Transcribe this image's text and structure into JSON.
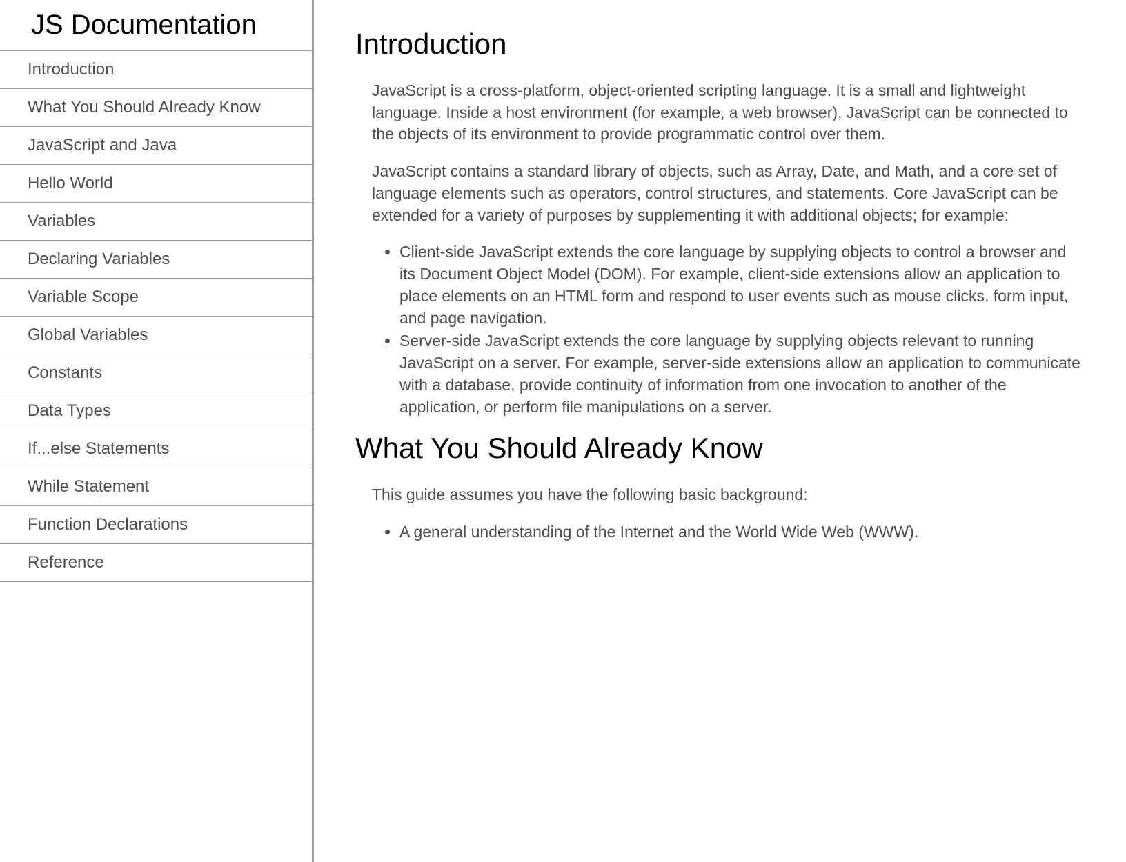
{
  "sidebar": {
    "title": "JS Documentation",
    "items": [
      "Introduction",
      "What You Should Already Know",
      "JavaScript and Java",
      "Hello World",
      "Variables",
      "Declaring Variables",
      "Variable Scope",
      "Global Variables",
      "Constants",
      "Data Types",
      "If...else Statements",
      "While Statement",
      "Function Declarations",
      "Reference"
    ]
  },
  "sections": {
    "introduction": {
      "heading": "Introduction",
      "p1": "JavaScript is a cross-platform, object-oriented scripting language. It is a small and lightweight language. Inside a host environment (for example, a web browser), JavaScript can be connected to the objects of its environment to provide programmatic control over them.",
      "p2": "JavaScript contains a standard library of objects, such as Array, Date, and Math, and a core set of language elements such as operators, control structures, and statements. Core JavaScript can be extended for a variety of purposes by supplementing it with additional objects; for example:",
      "li1": "Client-side JavaScript extends the core language by supplying objects to control a browser and its Document Object Model (DOM). For example, client-side extensions allow an application to place elements on an HTML form and respond to user events such as mouse clicks, form input, and page navigation.",
      "li2": "Server-side JavaScript extends the core language by supplying objects relevant to running JavaScript on a server. For example, server-side extensions allow an application to communicate with a database, provide continuity of information from one invocation to another of the application, or perform file manipulations on a server."
    },
    "whatYouShouldKnow": {
      "heading": "What You Should Already Know",
      "p1": "This guide assumes you have the following basic background:",
      "li1": "A general understanding of the Internet and the World Wide Web (WWW)."
    }
  }
}
